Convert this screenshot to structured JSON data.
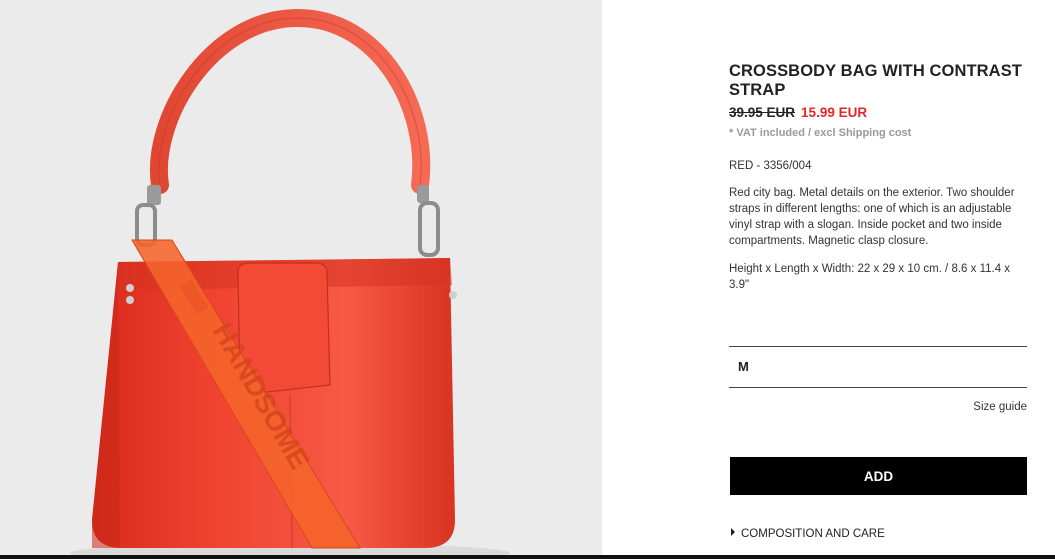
{
  "product": {
    "title": "CROSSBODY BAG WITH CONTRAST STRAP",
    "old_price": "39.95 EUR",
    "new_price": "15.99 EUR",
    "vat_note": "* VAT included / excl Shipping cost",
    "reference": "RED - 3356/004",
    "description": "Red city bag. Metal details on the exterior. Two shoulder straps in different lengths: one of which is an adjustable vinyl strap with a slogan. Inside pocket and two inside compartments. Magnetic clasp closure.",
    "dimensions": "Height x Length x Width: 22 x 29 x 10 cm. / 8.6 x 11.4 x 3.9\""
  },
  "size_selector": {
    "value": "M"
  },
  "size_guide_label": "Size guide",
  "add_label": "ADD",
  "composition_label": "COMPOSITION AND CARE",
  "image": {
    "strap_slogan": "HANDSOME"
  },
  "colors": {
    "bag_red": "#f2452e",
    "price_red": "#e3262a",
    "button_black": "#000000",
    "background_gray": "#eaeaea"
  }
}
